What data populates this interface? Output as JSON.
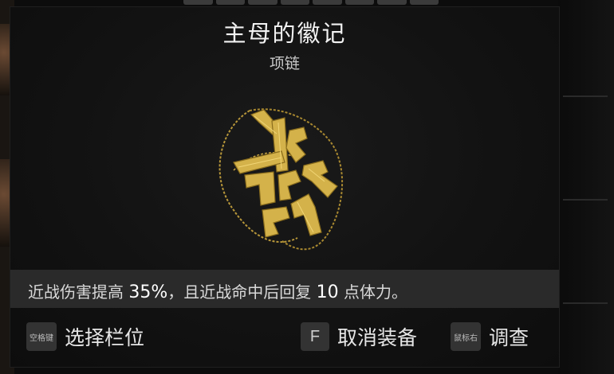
{
  "item": {
    "name": "主母的徽记",
    "type": "项链"
  },
  "description": {
    "part1": "近战伤害提高 ",
    "value1": "35%",
    "part2": "，且近战命中后回复 ",
    "value2": "10",
    "part3": " 点体力。"
  },
  "actions": [
    {
      "key": "空格键",
      "label": "选择栏位"
    },
    {
      "key": "F",
      "label": "取消装备"
    },
    {
      "key": "鼠标右",
      "label": "调查"
    }
  ],
  "colors": {
    "item_gold": "#d4b24a",
    "panel_bg": "#121212",
    "desc_bar": "#2a2a2a"
  },
  "icons": [
    "necklace-emblem-icon"
  ]
}
